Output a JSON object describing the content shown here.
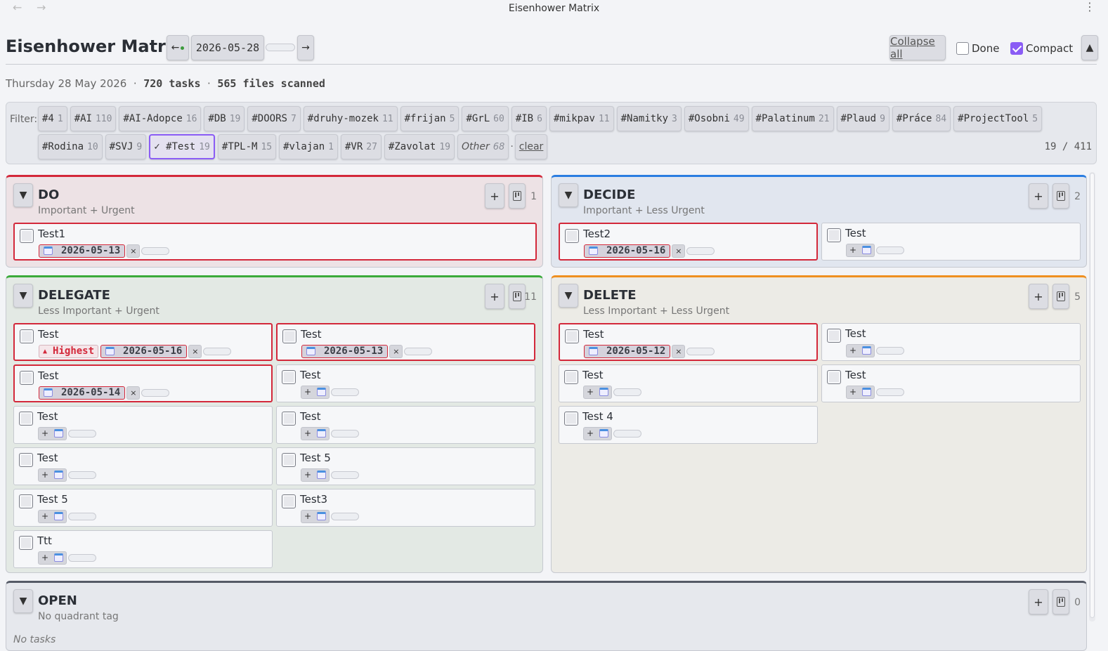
{
  "window": {
    "title": "Eisenhower Matrix",
    "back_glyph": "←",
    "fwd_glyph": "→",
    "more_glyph": "⋮"
  },
  "header": {
    "title": "Eisenhower Matrix",
    "prev_label": "←",
    "date": "2026-05-28",
    "next_label": "→",
    "collapse_all": "Collapse all",
    "done_label": "Done",
    "done_checked": false,
    "compact_label": "Compact",
    "compact_checked": true,
    "up_label": "▲"
  },
  "summary": {
    "date_text": "Thursday 28 May 2026",
    "tasks": "720 tasks",
    "files": "565 files scanned",
    "sep": "·"
  },
  "filter": {
    "label": "Filter:",
    "tags": [
      {
        "name": "#4",
        "count": "1"
      },
      {
        "name": "#AI",
        "count": "110"
      },
      {
        "name": "#AI-Adopce",
        "count": "16"
      },
      {
        "name": "#DB",
        "count": "19"
      },
      {
        "name": "#DOORS",
        "count": "7"
      },
      {
        "name": "#druhy-mozek",
        "count": "11"
      },
      {
        "name": "#frijan",
        "count": "5"
      },
      {
        "name": "#GrL",
        "count": "60"
      },
      {
        "name": "#IB",
        "count": "6"
      },
      {
        "name": "#mikpav",
        "count": "11"
      },
      {
        "name": "#Namitky",
        "count": "3"
      },
      {
        "name": "#Osobni",
        "count": "49"
      },
      {
        "name": "#Palatinum",
        "count": "21"
      },
      {
        "name": "#Plaud",
        "count": "9"
      },
      {
        "name": "#Práce",
        "count": "84"
      },
      {
        "name": "#ProjectTool",
        "count": "5"
      },
      {
        "name": "#Rodina",
        "count": "10"
      },
      {
        "name": "#SVJ",
        "count": "9"
      },
      {
        "name": "✓ #Test",
        "count": "19",
        "active": true
      },
      {
        "name": "#TPL-M",
        "count": "15"
      },
      {
        "name": "#vlajan",
        "count": "1"
      },
      {
        "name": "#VR",
        "count": "27"
      },
      {
        "name": "#Zavolat",
        "count": "19"
      }
    ],
    "other": {
      "name": "Other",
      "count": "68"
    },
    "sep": "·",
    "clear_label": "clear",
    "shown": "19 / 411"
  },
  "quadrants": {
    "do": {
      "title": "DO",
      "subtitle": "Important + Urgent",
      "count": "1",
      "cards": [
        {
          "title": "Test1",
          "date": "2026-05-13"
        }
      ]
    },
    "decide": {
      "title": "DECIDE",
      "subtitle": "Important + Less Urgent",
      "count": "2",
      "cards": [
        {
          "title": "Test2",
          "date": "2026-05-16"
        },
        {
          "title": "Test"
        }
      ]
    },
    "delegate": {
      "title": "DELEGATE",
      "subtitle": "Less Important + Urgent",
      "count": "11",
      "cards": [
        {
          "title": "Test",
          "priority": "Highest",
          "date": "2026-05-16"
        },
        {
          "title": "Test",
          "date": "2026-05-13"
        },
        {
          "title": "Test",
          "date": "2026-05-14"
        },
        {
          "title": "Test"
        },
        {
          "title": "Test"
        },
        {
          "title": "Test"
        },
        {
          "title": "Test"
        },
        {
          "title": "Test 5"
        },
        {
          "title": "Test 5"
        },
        {
          "title": "Test3"
        },
        {
          "title": "Ttt"
        }
      ]
    },
    "delete": {
      "title": "DELETE",
      "subtitle": "Less Important + Less Urgent",
      "count": "5",
      "cards": [
        {
          "title": "Test",
          "date": "2026-05-12"
        },
        {
          "title": "Test"
        },
        {
          "title": "Test"
        },
        {
          "title": "Test"
        },
        {
          "title": "Test 4"
        }
      ]
    },
    "open": {
      "title": "OPEN",
      "subtitle": "No quadrant tag",
      "count": "0",
      "empty_text": "No tasks"
    }
  },
  "icons": {
    "toggle": "triangle-down-icon",
    "add": "plus-icon",
    "board": "board-icon",
    "calendar": "calendar-icon",
    "remove": "x-icon"
  },
  "glyphs": {
    "toggle": "▼",
    "add": "+",
    "remove": "×",
    "priority": "▲"
  },
  "colors": {
    "do": "#d3283a",
    "decide": "#2a7de1",
    "delegate": "#3aaa3a",
    "delete": "#ef8f20",
    "open": "#555a66",
    "accent": "#8a5cf5",
    "overdue": "#d3283a"
  }
}
